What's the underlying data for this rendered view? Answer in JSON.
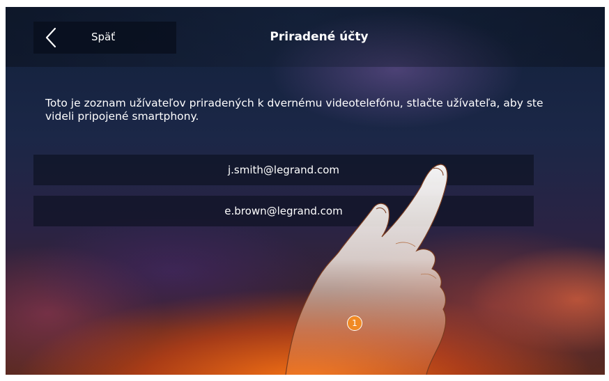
{
  "header": {
    "back_label": "Späť",
    "title": "Priradené účty"
  },
  "description": "Toto je zoznam užívateľov priradených k dvernému videotelefónu, stlačte užívateľa, aby ste videli pripojené smartphony.",
  "accounts": [
    {
      "email": "j.smith@legrand.com"
    },
    {
      "email": "e.brown@legrand.com"
    }
  ],
  "annotation": {
    "step_number": "1"
  },
  "colors": {
    "accent_orange": "#f08a24",
    "panel_dark": "#0c101e",
    "text": "#ffffff"
  },
  "icons": {
    "back": "chevron-left-icon",
    "hand": "pointing-hand-icon"
  }
}
